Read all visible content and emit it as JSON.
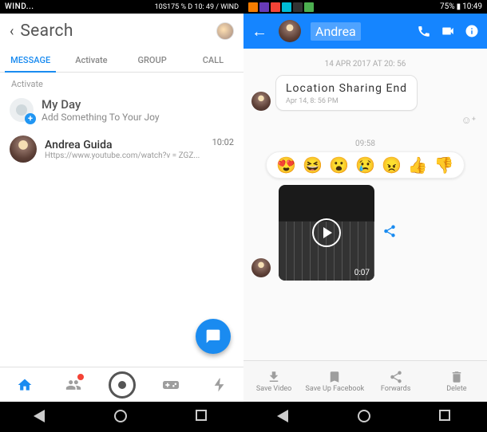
{
  "status": {
    "left_carrier": "WIND...",
    "left_extra": "10S175 % D 10: 49 / WIND",
    "right_battery": "75%",
    "right_time": "10:49"
  },
  "left": {
    "search_placeholder": "Search",
    "tabs": {
      "message": "MESSAGE",
      "activate": "Activate",
      "group": "GROUP",
      "call": "CALL"
    },
    "active_label": "Activate",
    "myday": {
      "title": "My Day",
      "subtitle": "Add Something To Your Joy"
    },
    "convo": {
      "name": "Andrea Guida",
      "preview": "Https://www.youtube.com/watch?v = ZGZ...",
      "time": "10:02"
    }
  },
  "right": {
    "header_name": "Andrea",
    "ts1": "14 APR 2017 AT 20: 56",
    "bubble_title": "Location Sharing End",
    "bubble_time": "Apr 14, 8: 56 PM",
    "ts2": "09:58",
    "duration": "0:07",
    "actions": {
      "save_video": "Save Video",
      "save_fb": "Save Up Facebook",
      "forward": "Forwards",
      "delete": "Delete"
    },
    "reactions": [
      "😍",
      "😆",
      "😮",
      "😢",
      "😠",
      "👍",
      "👎"
    ]
  }
}
